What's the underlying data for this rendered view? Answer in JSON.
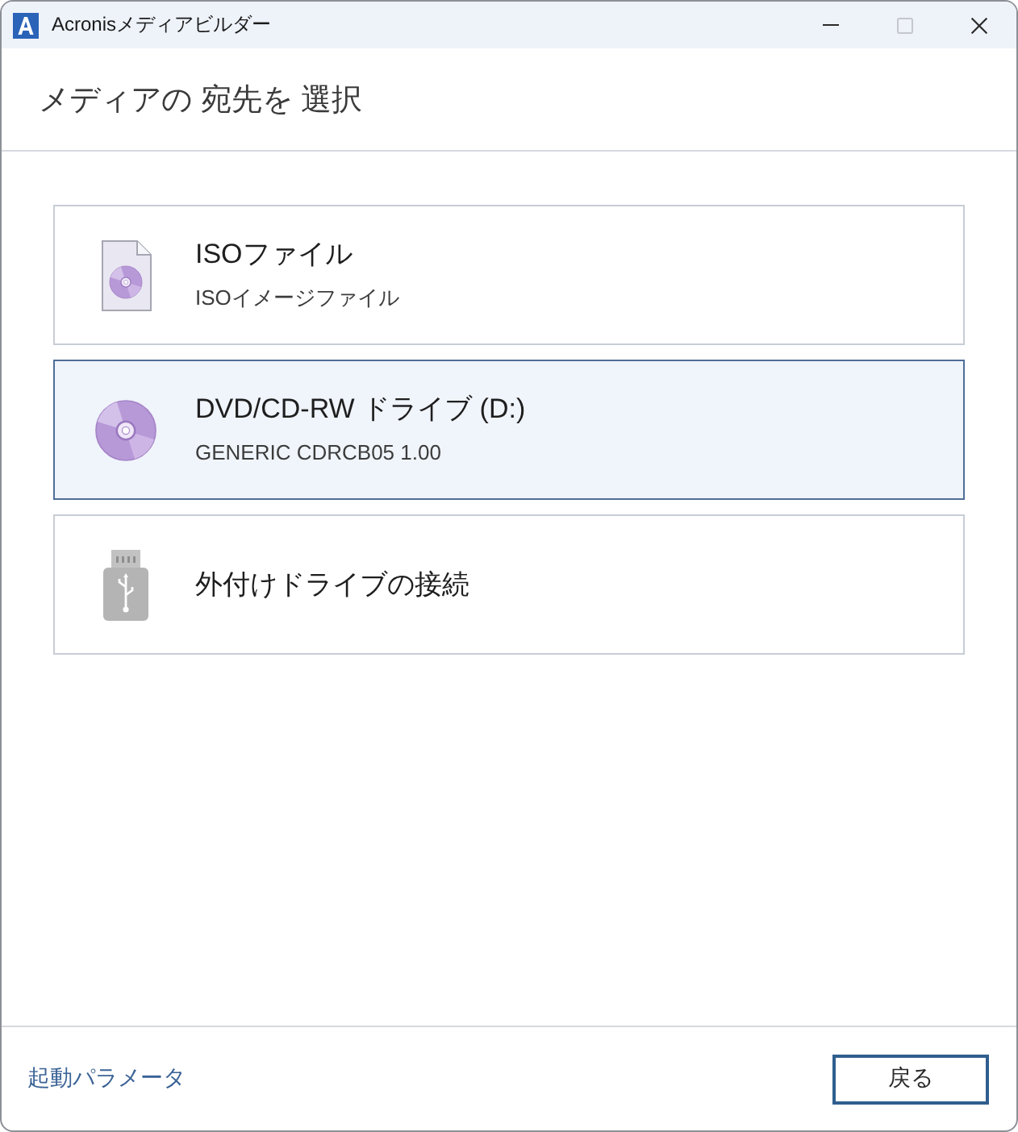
{
  "window": {
    "title": "Acronisメディアビルダー",
    "controls": [
      {
        "kind": "minimize",
        "disabled": false
      },
      {
        "kind": "maximize",
        "disabled": true
      },
      {
        "kind": "close",
        "disabled": false
      }
    ]
  },
  "header": {
    "title": "メディアの 宛先を 選択"
  },
  "options": [
    {
      "kind": "iso-file",
      "title": "ISOファイル",
      "subtitle": "ISOイメージファイル",
      "selected": false
    },
    {
      "kind": "optical-drive",
      "title": "DVD/CD-RW ドライブ (D:)",
      "subtitle": "GENERIC CDRCB05 1.00",
      "selected": true
    },
    {
      "kind": "usb-drive",
      "title": "外付けドライブの接続",
      "selected": false
    }
  ],
  "footer": {
    "link": "起動パラメータ",
    "back_button": "戻る"
  }
}
